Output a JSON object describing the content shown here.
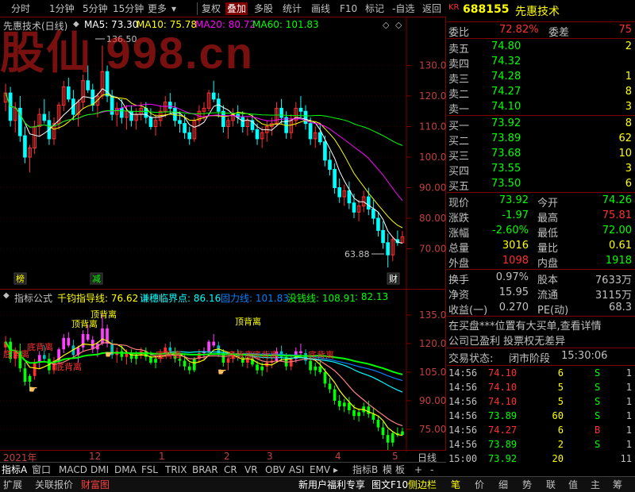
{
  "toolbar": {
    "left_items": [
      "分时",
      "1分钟",
      "5分钟",
      "15分钟",
      "更多"
    ],
    "right_items": [
      "复权",
      "叠加",
      "多股",
      "统计",
      "画线",
      "F10",
      "标记",
      "-自选",
      "返回"
    ],
    "active_item": "叠加"
  },
  "main_chart": {
    "title": "先惠技术(日线)",
    "ma_labels": [
      {
        "text": "MA5: 73.30",
        "color": "#ffffff"
      },
      {
        "text": "MA10: 75.78",
        "color": "#ffff00"
      },
      {
        "text": "MA20: 80.72",
        "color": "#ff00ff"
      },
      {
        "text": "MA60: 101.83",
        "color": "#00ff00"
      }
    ],
    "watermark": "股仙 998.cn",
    "y_ticks": [
      "130.0",
      "120.0",
      "110.0",
      "100.0",
      "90.00",
      "80.00",
      "70.00"
    ],
    "high_marker": "136.50",
    "low_marker": "63.88",
    "event_tags": [
      {
        "text": "榜",
        "color": "#ffff00"
      },
      {
        "text": "减",
        "color": "#00ff00"
      },
      {
        "text": "财",
        "color": "#ffffff"
      }
    ]
  },
  "indicator_chart": {
    "title": "指标公式",
    "labels": [
      {
        "text": "千钧指导线: 76.62",
        "color": "#ffff00"
      },
      {
        "text": "谦穗临界点: 86.16",
        "color": "#00ffff"
      },
      {
        "text": "固力线: 101.83",
        "color": "#0080ff"
      },
      {
        "text": "没钱线: 108.91",
        "color": "#00ff00"
      },
      {
        "text": ": 82.13",
        "color": "#00ff00"
      }
    ],
    "y_ticks": [
      "135.0",
      "120.0",
      "105.0",
      "90.00",
      "75.00"
    ],
    "annotations": [
      {
        "text": "底背离",
        "color": "#ff3030"
      },
      {
        "text": "底背离",
        "color": "#ff3030"
      },
      {
        "text": "顶背离",
        "color": "#ffff00"
      },
      {
        "text": "顶背离",
        "color": "#ffff00"
      },
      {
        "text": "底背离",
        "color": "#ff3030"
      },
      {
        "text": "顶背离",
        "color": "#ffff00"
      },
      {
        "text": "底背离",
        "color": "#ff3030"
      },
      {
        "text": "底背离",
        "color": "#ff3030"
      },
      {
        "text": "底背离",
        "color": "#ff3030"
      },
      {
        "text": "底背离",
        "color": "#ff3030"
      }
    ]
  },
  "date_axis": {
    "labels": [
      "2021年",
      "12",
      "1",
      "2",
      "3",
      "4",
      "5"
    ],
    "period": "日线"
  },
  "indicator_tabs": {
    "items": [
      "指标A",
      "窗口",
      "MACD",
      "DMI",
      "DMA",
      "FSL",
      "TRIX",
      "BRAR",
      "CR",
      "VR",
      "OBV",
      "ASI",
      "EMV"
    ],
    "right_items": [
      "指标B",
      "模",
      "板",
      "+",
      "-"
    ]
  },
  "status_bar": {
    "left_items": [
      {
        "text": "扩展",
        "color": "#c0c0c0"
      },
      {
        "text": "关联报价",
        "color": "#c0c0c0"
      },
      {
        "text": "财富图",
        "color": "#ff4040"
      }
    ],
    "center_items": [
      {
        "text": "新用户福利专享",
        "color": "#ffffff"
      },
      {
        "text": "图文F10",
        "color": "#ffffff"
      },
      {
        "text": "侧边栏",
        "color": "#ffff00"
      }
    ],
    "right_items": [
      "笔",
      "价",
      "细",
      "势",
      "联",
      "值",
      "主",
      "筹"
    ]
  },
  "quote": {
    "badge": "KR",
    "code": "688155",
    "name": "先惠技术",
    "weibi_label": "委比",
    "weibi": "72.82%",
    "weicha_label": "委差",
    "weicha": "75",
    "asks": [
      {
        "label": "卖五",
        "price": "74.80",
        "vol": "2"
      },
      {
        "label": "卖四",
        "price": "74.32",
        "vol": ""
      },
      {
        "label": "卖三",
        "price": "74.28",
        "vol": "1"
      },
      {
        "label": "卖二",
        "price": "74.27",
        "vol": "8"
      },
      {
        "label": "卖一",
        "price": "74.10",
        "vol": "3"
      }
    ],
    "bids": [
      {
        "label": "买一",
        "price": "73.92",
        "vol": "8"
      },
      {
        "label": "买二",
        "price": "73.89",
        "vol": "62"
      },
      {
        "label": "买三",
        "price": "73.68",
        "vol": "10"
      },
      {
        "label": "买四",
        "price": "73.55",
        "vol": "3"
      },
      {
        "label": "买五",
        "price": "73.50",
        "vol": "6"
      }
    ],
    "stats": [
      {
        "l1": "现价",
        "v1": "73.92",
        "c1": "#00ff00",
        "l2": "今开",
        "v2": "74.26",
        "c2": "#00ff00"
      },
      {
        "l1": "涨跌",
        "v1": "-1.97",
        "c1": "#00ff00",
        "l2": "最高",
        "v2": "75.81",
        "c2": "#ff3030"
      },
      {
        "l1": "涨幅",
        "v1": "-2.60%",
        "c1": "#00ff00",
        "l2": "最低",
        "v2": "72.00",
        "c2": "#00ff00"
      },
      {
        "l1": "总量",
        "v1": "3016",
        "c1": "#ffff00",
        "l2": "量比",
        "v2": "0.61",
        "c2": "#ffff00"
      },
      {
        "l1": "外盘",
        "v1": "1098",
        "c1": "#ff3030",
        "l2": "内盘",
        "v2": "1918",
        "c2": "#00ff00"
      }
    ],
    "stats2": [
      {
        "l1": "换手",
        "v1": "0.97%",
        "l2": "股本",
        "v2": "7633万"
      },
      {
        "l1": "净资",
        "v1": "15.95",
        "l2": "流通",
        "v2": "3115万"
      },
      {
        "l1": "收益(一)",
        "v1": "0.270",
        "l2": "PE(动)",
        "v2": "68.3"
      }
    ],
    "news": [
      "在买盘***位置有大买单,查看详情",
      "公司已盈利 投票权无差异"
    ],
    "trade_status_label": "交易状态:",
    "trade_status": "闭市阶段",
    "trade_time": "15:30:06",
    "ticks": [
      {
        "time": "14:56",
        "price": "74.10",
        "pc": "#ff3030",
        "vol": "6",
        "side": "S",
        "sc": "#00ff00",
        "n": "1"
      },
      {
        "time": "14:56",
        "price": "74.10",
        "pc": "#ff3030",
        "vol": "5",
        "side": "S",
        "sc": "#00ff00",
        "n": "1"
      },
      {
        "time": "14:56",
        "price": "74.10",
        "pc": "#ff3030",
        "vol": "5",
        "side": "S",
        "sc": "#00ff00",
        "n": "1"
      },
      {
        "time": "14:56",
        "price": "73.89",
        "pc": "#00ff00",
        "vol": "60",
        "side": "S",
        "sc": "#00ff00",
        "n": "1"
      },
      {
        "time": "14:56",
        "price": "74.27",
        "pc": "#ff3030",
        "vol": "6",
        "side": "B",
        "sc": "#ff3030",
        "n": "1"
      },
      {
        "time": "14:56",
        "price": "73.89",
        "pc": "#00ff00",
        "vol": "2",
        "side": "S",
        "sc": "#00ff00",
        "n": "1"
      },
      {
        "time": "15:00",
        "price": "73.92",
        "pc": "#00ff00",
        "vol": "20",
        "side": "",
        "sc": "#00ff00",
        "n": "11"
      }
    ]
  },
  "chart_data": {
    "type": "candlestick",
    "ylim": [
      60,
      140
    ],
    "candles": [
      [
        118,
        124,
        115,
        121
      ],
      [
        121,
        123,
        110,
        112
      ],
      [
        112,
        118,
        108,
        116
      ],
      [
        116,
        120,
        105,
        107
      ],
      [
        107,
        110,
        98,
        100
      ],
      [
        100,
        104,
        95,
        103
      ],
      [
        103,
        112,
        101,
        110
      ],
      [
        110,
        116,
        107,
        114
      ],
      [
        114,
        119,
        111,
        112
      ],
      [
        112,
        115,
        104,
        106
      ],
      [
        106,
        113,
        104,
        111
      ],
      [
        111,
        118,
        109,
        117
      ],
      [
        117,
        125,
        115,
        123
      ],
      [
        123,
        126,
        118,
        119
      ],
      [
        119,
        122,
        112,
        114
      ],
      [
        114,
        119,
        110,
        118
      ],
      [
        118,
        127,
        116,
        125
      ],
      [
        125,
        130,
        121,
        122
      ],
      [
        122,
        124,
        115,
        117
      ],
      [
        117,
        121,
        113,
        120
      ],
      [
        120,
        136.5,
        119,
        128
      ],
      [
        128,
        130,
        118,
        120
      ],
      [
        120,
        122,
        112,
        114
      ],
      [
        114,
        118,
        110,
        116
      ],
      [
        116,
        119,
        111,
        113
      ],
      [
        113,
        117,
        109,
        115
      ],
      [
        115,
        117,
        110,
        112
      ],
      [
        112,
        116,
        109,
        114
      ],
      [
        114,
        118,
        112,
        116
      ],
      [
        116,
        118,
        111,
        113
      ],
      [
        113,
        116,
        109,
        110
      ],
      [
        110,
        114,
        107,
        112
      ],
      [
        112,
        117,
        110,
        115
      ],
      [
        115,
        120,
        113,
        118
      ],
      [
        118,
        121,
        114,
        116
      ],
      [
        116,
        118,
        110,
        112
      ],
      [
        112,
        115,
        108,
        111
      ],
      [
        111,
        114,
        106,
        108
      ],
      [
        108,
        110,
        104,
        106
      ],
      [
        106,
        113,
        105,
        112
      ],
      [
        112,
        117,
        110,
        115
      ],
      [
        115,
        118,
        112,
        116
      ],
      [
        116,
        122,
        115,
        121
      ],
      [
        121,
        125,
        118,
        119
      ],
      [
        119,
        121,
        113,
        115
      ],
      [
        115,
        117,
        108,
        110
      ],
      [
        110,
        113,
        106,
        112
      ],
      [
        112,
        116,
        110,
        114
      ],
      [
        114,
        117,
        111,
        113
      ],
      [
        113,
        115,
        108,
        110
      ],
      [
        110,
        113,
        107,
        112
      ],
      [
        112,
        114,
        108,
        109
      ],
      [
        109,
        111,
        104,
        106
      ],
      [
        106,
        110,
        103,
        108
      ],
      [
        108,
        112,
        105,
        110
      ],
      [
        110,
        113,
        107,
        111
      ],
      [
        111,
        118,
        110,
        116
      ],
      [
        116,
        119,
        111,
        113
      ],
      [
        113,
        115,
        106,
        108
      ],
      [
        108,
        114,
        106,
        112
      ],
      [
        112,
        118,
        110,
        116
      ],
      [
        116,
        120,
        113,
        115
      ],
      [
        115,
        117,
        109,
        111
      ],
      [
        111,
        113,
        104,
        106
      ],
      [
        106,
        110,
        103,
        108
      ],
      [
        108,
        111,
        104,
        105
      ],
      [
        105,
        107,
        97,
        99
      ],
      [
        99,
        102,
        94,
        96
      ],
      [
        96,
        98,
        88,
        90
      ],
      [
        90,
        93,
        85,
        87
      ],
      [
        87,
        91,
        84,
        89
      ],
      [
        89,
        92,
        83,
        85
      ],
      [
        85,
        88,
        80,
        82
      ],
      [
        82,
        86,
        79,
        84
      ],
      [
        84,
        89,
        82,
        87
      ],
      [
        87,
        90,
        81,
        83
      ],
      [
        83,
        86,
        78,
        80
      ],
      [
        80,
        82,
        74,
        76
      ],
      [
        76,
        79,
        70,
        72
      ],
      [
        72,
        75,
        63.88,
        68
      ],
      [
        68,
        74,
        66,
        73
      ],
      [
        73,
        76,
        71,
        72
      ],
      [
        72,
        75.81,
        72,
        73.92
      ]
    ]
  }
}
